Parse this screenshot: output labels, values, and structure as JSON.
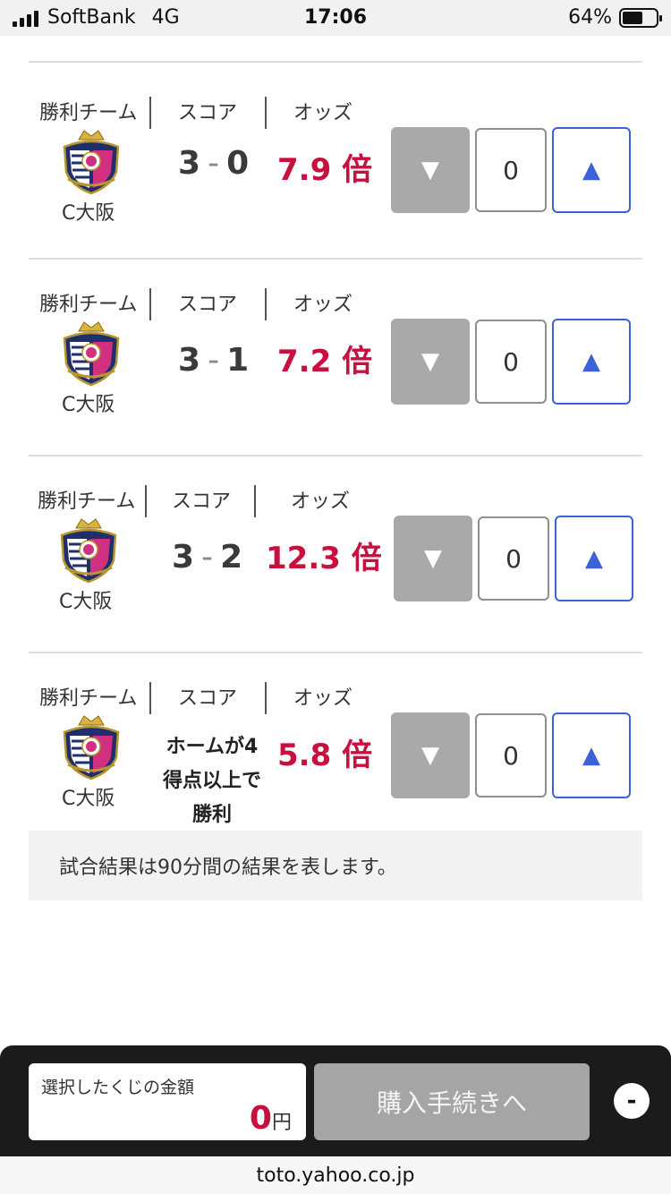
{
  "status_bar": {
    "carrier": "SoftBank",
    "network": "4G",
    "time": "17:06",
    "battery": "64%"
  },
  "header_labels": {
    "team": "勝利チーム",
    "score": "スコア",
    "odds": "オッズ"
  },
  "rows": [
    {
      "team": "C大阪",
      "score_home": "3",
      "score_sep": "-",
      "score_away": "0",
      "odds": "7.9 倍",
      "qty": "0"
    },
    {
      "team": "C大阪",
      "score_home": "3",
      "score_sep": "-",
      "score_away": "1",
      "odds": "7.2 倍",
      "qty": "0"
    },
    {
      "team": "C大阪",
      "score_home": "3",
      "score_sep": "-",
      "score_away": "2",
      "odds": "12.3 倍",
      "qty": "0"
    },
    {
      "team": "C大阪",
      "score_text": [
        "ホームが4",
        "得点以上で",
        "勝利"
      ],
      "odds": "5.8 倍",
      "qty": "0"
    }
  ],
  "controls": {
    "down_icon": "▼",
    "up_icon": "▲"
  },
  "note": "試合結果は90分間の結果を表します。",
  "footer": {
    "amount_label": "選択したくじの金額",
    "amount_value": "0",
    "amount_unit": "円",
    "purchase_label": "購入手続きへ",
    "collapse_label": "-"
  },
  "url": "toto.yahoo.co.jp",
  "colors": {
    "odds": "#c8103e",
    "up_button": "#3b62d9",
    "down_button": "#a9a9a9"
  }
}
